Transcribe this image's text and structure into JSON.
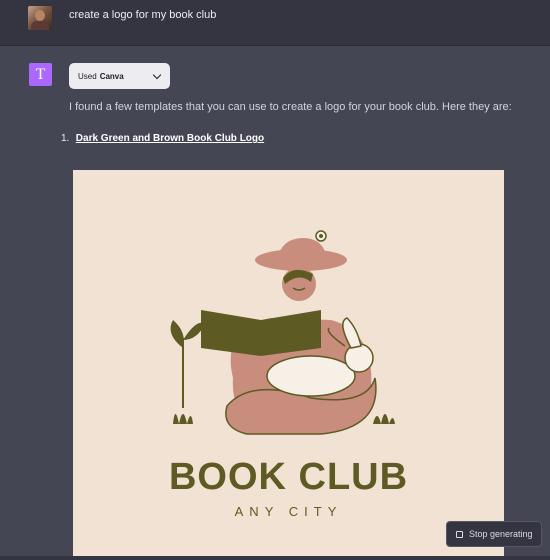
{
  "user": {
    "message": "create a logo for my book club"
  },
  "assistant": {
    "avatar_letter": "T",
    "plugin_prefix": "Used",
    "plugin_name": "Canva",
    "intro": "I found a few templates that you can use to create a logo for your book club. Here they are:",
    "results": [
      {
        "number": "1.",
        "title": "Dark Green and Brown Book Club Logo"
      }
    ],
    "preview": {
      "title": "BOOK CLUB",
      "subtitle": "ANY CITY"
    }
  },
  "controls": {
    "stop_label": "Stop generating"
  },
  "colors": {
    "page_bg": "#444654",
    "user_row_bg": "#343541",
    "assistant_avatar": "#ab68ff",
    "canvas_bg": "#f1e2d3",
    "logo_olive": "#5d5a23",
    "logo_rose": "#c88d7d"
  },
  "icons": {
    "user_avatar": "user-photo",
    "assistant_avatar": "letter-avatar",
    "dropdown": "chevron-down-icon",
    "stop": "square-stop-icon"
  }
}
